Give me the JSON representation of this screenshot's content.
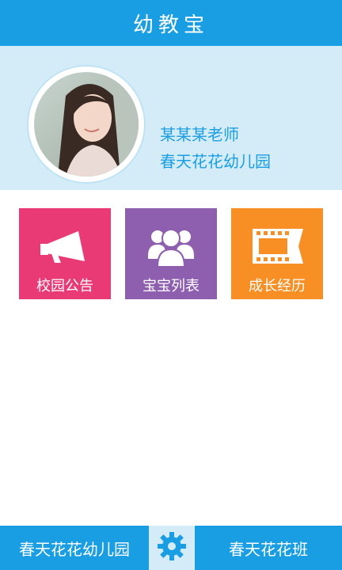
{
  "header": {
    "title": "幼教宝"
  },
  "profile": {
    "teacher": "某某某老师",
    "school": "春天花花幼儿园"
  },
  "tiles": [
    {
      "label": "校园公告",
      "icon": "megaphone-icon",
      "color": "#e93a76"
    },
    {
      "label": "宝宝列表",
      "icon": "group-icon",
      "color": "#8e5fae"
    },
    {
      "label": "成长经历",
      "icon": "film-icon",
      "color": "#f88f24"
    }
  ],
  "bottom": {
    "school": "春天花花幼儿园",
    "settings_icon": "gear-icon",
    "class": "春天花花班"
  },
  "colors": {
    "primary": "#1a9ee3",
    "light": "#d4ecf8"
  }
}
